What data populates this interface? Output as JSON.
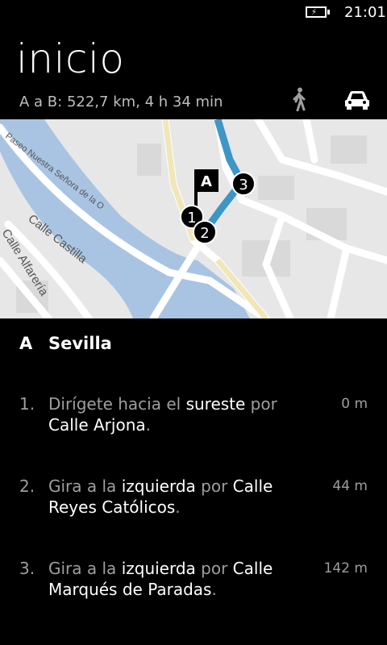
{
  "status_bar": {
    "time": "21:01",
    "battery_icon": "battery-charging-icon"
  },
  "page": {
    "title": "inicio"
  },
  "route_summary": {
    "label": "A a B:",
    "value": "522,7 km, 4 h 34 min"
  },
  "travel_modes": [
    {
      "name": "walk",
      "icon": "walking-person-icon",
      "selected": false
    },
    {
      "name": "car",
      "icon": "car-icon",
      "selected": true
    }
  ],
  "map": {
    "start_marker": "A",
    "waypoints": [
      "1",
      "2",
      "3"
    ],
    "street_labels": [
      "Paseo Nuestra Señora de la O",
      "Calle Castilla",
      "Calle Alfarería"
    ],
    "colors": {
      "water": "#a9c4e2",
      "route": "#3d96c6",
      "road": "#ffffff",
      "land": "#e7e7e7"
    }
  },
  "start_point": {
    "letter": "A",
    "city": "Sevilla"
  },
  "steps": [
    {
      "number": "1.",
      "parts": [
        [
          "Dirígete hacia el ",
          false
        ],
        [
          "sureste",
          true
        ],
        [
          " por ",
          false
        ],
        [
          "Calle Arjona",
          true
        ],
        [
          ".",
          false
        ]
      ],
      "distance": "0 m"
    },
    {
      "number": "2.",
      "parts": [
        [
          "Gira a la ",
          false
        ],
        [
          "izquierda",
          true
        ],
        [
          " por ",
          false
        ],
        [
          "Calle Reyes Católicos",
          true
        ],
        [
          ".",
          false
        ]
      ],
      "distance": "44 m"
    },
    {
      "number": "3.",
      "parts": [
        [
          "Gira a la ",
          false
        ],
        [
          "izquierda",
          true
        ],
        [
          " por ",
          false
        ],
        [
          "Calle Marqués de Paradas",
          true
        ],
        [
          ".",
          false
        ]
      ],
      "distance": "142 m"
    }
  ]
}
